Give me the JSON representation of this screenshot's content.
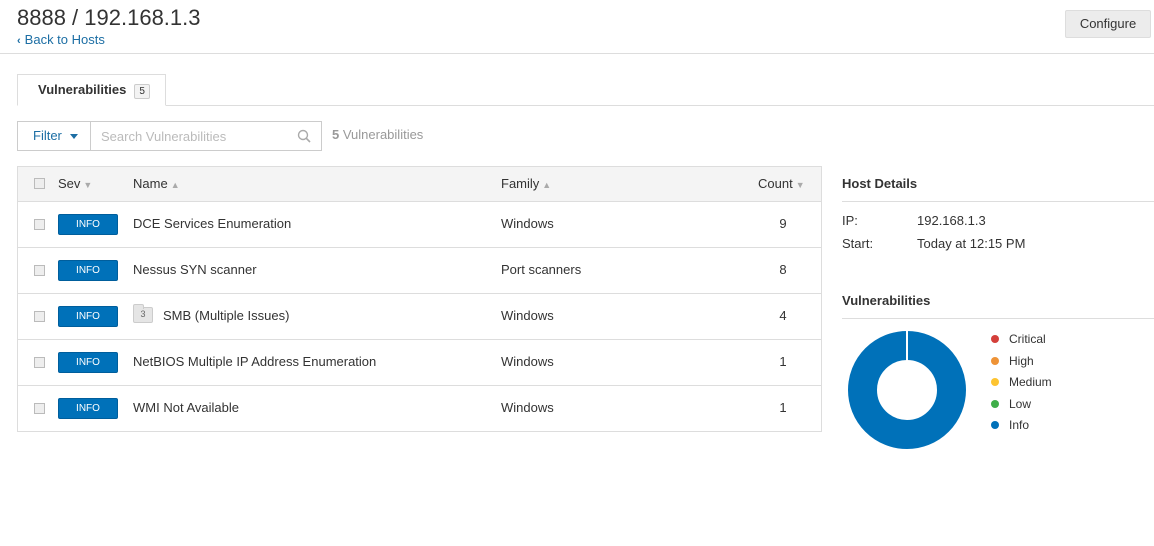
{
  "header": {
    "title": "8888 / 192.168.1.3",
    "back_label": "Back to Hosts",
    "configure_label": "Configure"
  },
  "tabs": [
    {
      "label": "Vulnerabilities",
      "count": "5"
    }
  ],
  "toolbar": {
    "filter_label": "Filter",
    "search_placeholder": "Search Vulnerabilities",
    "result_count": "5",
    "result_suffix": "Vulnerabilities"
  },
  "table": {
    "columns": {
      "sev": "Sev",
      "name": "Name",
      "family": "Family",
      "count": "Count"
    },
    "rows": [
      {
        "sev": "INFO",
        "name": "DCE Services Enumeration",
        "family": "Windows",
        "count": "9"
      },
      {
        "sev": "INFO",
        "name": "Nessus SYN scanner",
        "family": "Port scanners",
        "count": "8"
      },
      {
        "sev": "INFO",
        "group_count": "3",
        "name": "SMB (Multiple Issues)",
        "family": "Windows",
        "count": "4"
      },
      {
        "sev": "INFO",
        "name": "NetBIOS Multiple IP Address Enumeration",
        "family": "Windows",
        "count": "1"
      },
      {
        "sev": "INFO",
        "name": "WMI Not Available",
        "family": "Windows",
        "count": "1"
      }
    ]
  },
  "host_details": {
    "heading": "Host Details",
    "ip_label": "IP:",
    "ip_value": "192.168.1.3",
    "start_label": "Start:",
    "start_value": "Today at 12:15 PM"
  },
  "vulnerabilities_panel": {
    "heading": "Vulnerabilities",
    "legend": [
      {
        "label": "Critical",
        "color": "#d43f3a"
      },
      {
        "label": "High",
        "color": "#ee9336"
      },
      {
        "label": "Medium",
        "color": "#fdc431"
      },
      {
        "label": "Low",
        "color": "#3fae49"
      },
      {
        "label": "Info",
        "color": "#0071b9"
      }
    ]
  },
  "colors": {
    "accent": "#1c6ea4",
    "info": "#0071b9"
  }
}
